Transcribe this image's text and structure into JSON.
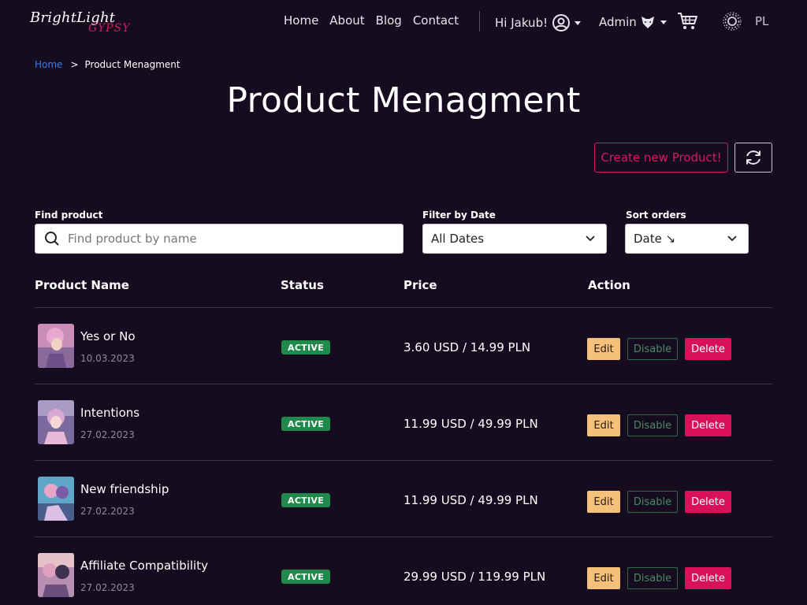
{
  "brand": {
    "line1": "BrightLight",
    "line2": "GYPSY"
  },
  "nav": {
    "links": [
      "Home",
      "About",
      "Blog",
      "Contact"
    ],
    "greeting": "Hi Jakub!",
    "admin_label": "Admin",
    "language": "PL"
  },
  "breadcrumb": {
    "home": "Home",
    "separator": ">",
    "current": "Product Menagment"
  },
  "page": {
    "title": "Product Menagment"
  },
  "toolbar": {
    "create_label": "Create new Product!"
  },
  "filters": {
    "search": {
      "label": "Find product",
      "placeholder": "Find product by name",
      "value": ""
    },
    "date": {
      "label": "Filter by Date",
      "value": "All Dates"
    },
    "sort": {
      "label": "Sort orders",
      "value": "Date ↘"
    }
  },
  "table": {
    "headers": [
      "Product Name",
      "Status",
      "Price",
      "Action"
    ],
    "rows": [
      {
        "name": "Yes or No",
        "date": "10.03.2023",
        "status": "ACTIVE",
        "price": "3.60 USD / 14.99 PLN"
      },
      {
        "name": "Intentions",
        "date": "27.02.2023",
        "status": "ACTIVE",
        "price": "11.99 USD / 49.99 PLN"
      },
      {
        "name": "New friendship",
        "date": "27.02.2023",
        "status": "ACTIVE",
        "price": "11.99 USD / 49.99 PLN"
      },
      {
        "name": "Affiliate Compatibility",
        "date": "27.02.2023",
        "status": "ACTIVE",
        "price": "29.99 USD / 119.99 PLN"
      }
    ],
    "actions": {
      "edit": "Edit",
      "disable": "Disable",
      "delete": "Delete"
    }
  },
  "colors": {
    "background": "#150c1f",
    "accent": "#d8185e",
    "active_badge": "#1f8a4c",
    "edit": "#f5c07a",
    "link": "#3b7cf0"
  },
  "icons": {
    "search": "search-icon",
    "user": "user-circle-icon",
    "admin": "admin-mask-icon",
    "cart": "cart-icon",
    "theme": "sun-icon",
    "refresh": "refresh-icon",
    "chevron": "chevron-down-icon"
  }
}
